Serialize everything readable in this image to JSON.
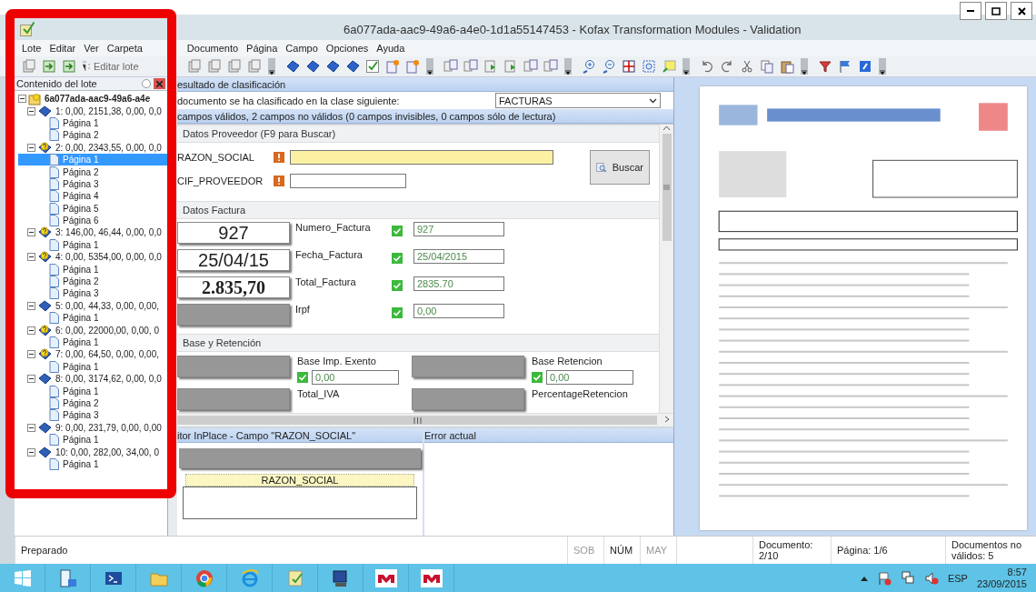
{
  "window": {
    "title": "6a077ada-aac9-49a6-a4e0-1d1a55147453 - Kofax Transformation Modules - Validation"
  },
  "menu": [
    "Lote",
    "Editar",
    "Ver",
    "Carpeta",
    "Documento",
    "Página",
    "Campo",
    "Opciones",
    "Ayuda"
  ],
  "batch_toolbar": {
    "button": "Editar lote"
  },
  "batch_panel": {
    "title": "Contenido del lote",
    "root": {
      "label": "6a077ada-aac9-49a6-a4e",
      "expanded": true,
      "children": [
        {
          "label": "1: 0,00, 2151,38, 0,00, 0,0",
          "valid": true,
          "expanded": true,
          "children": [
            {
              "label": "Página 1",
              "selected": false
            },
            {
              "label": "Página 2",
              "selected": false
            }
          ]
        },
        {
          "label": "2: 0,00, 2343,55, 0,00, 0,0",
          "valid": false,
          "expanded": true,
          "children": [
            {
              "label": "Página 1",
              "selected": true
            },
            {
              "label": "Página 2",
              "selected": false
            },
            {
              "label": "Página 3",
              "selected": false
            },
            {
              "label": "Página 4",
              "selected": false
            },
            {
              "label": "Página 5",
              "selected": false
            },
            {
              "label": "Página 6",
              "selected": false
            }
          ]
        },
        {
          "label": "3: 146,00, 46,44, 0,00, 0,0",
          "valid": false,
          "expanded": true,
          "children": [
            {
              "label": "Página 1",
              "selected": false
            }
          ]
        },
        {
          "label": "4: 0,00, 5354,00, 0,00, 0,0",
          "valid": false,
          "expanded": true,
          "children": [
            {
              "label": "Página 1",
              "selected": false
            },
            {
              "label": "Página 2",
              "selected": false
            },
            {
              "label": "Página 3",
              "selected": false
            }
          ]
        },
        {
          "label": "5: 0,00, 44,33, 0,00, 0,00,",
          "valid": true,
          "expanded": true,
          "children": [
            {
              "label": "Página 1",
              "selected": false
            }
          ]
        },
        {
          "label": "6: 0,00, 22000,00, 0,00, 0",
          "valid": false,
          "expanded": true,
          "children": [
            {
              "label": "Página 1",
              "selected": false
            }
          ]
        },
        {
          "label": "7: 0,00, 64,50, 0,00, 0,00,",
          "valid": false,
          "expanded": true,
          "children": [
            {
              "label": "Página 1",
              "selected": false
            }
          ]
        },
        {
          "label": "8: 0,00, 3174,62, 0,00, 0,0",
          "valid": true,
          "expanded": true,
          "children": [
            {
              "label": "Página 1",
              "selected": false
            },
            {
              "label": "Página 2",
              "selected": false
            },
            {
              "label": "Página 3",
              "selected": false
            }
          ]
        },
        {
          "label": "9: 0,00, 231,79, 0,00, 0,00",
          "valid": true,
          "expanded": true,
          "children": [
            {
              "label": "Página 1",
              "selected": false
            }
          ]
        },
        {
          "label": "10: 0,00, 282,00, 34,00, 0",
          "valid": true,
          "expanded": true,
          "children": [
            {
              "label": "Página 1",
              "selected": false
            }
          ]
        }
      ]
    }
  },
  "classification": {
    "title": "esultado de clasificación",
    "text": "documento se ha clasificado en la clase siguiente:",
    "class": "FACTURAS"
  },
  "validation_summary": "campos válidos, 2 campos no válidos (0 campos invisibles, 0 campos sólo de lectura)",
  "sections": [
    {
      "title": "Datos Proveedor (F9 para Buscar)",
      "kind": "search",
      "button": "Buscar",
      "fields": [
        {
          "kind": "text",
          "label": "RAZON_SOCIAL",
          "valid": false,
          "selected": true
        },
        {
          "kind": "text",
          "label": "CIF_PROVEEDOR",
          "valid": false,
          "selected": false
        }
      ]
    },
    {
      "title": "Datos Factura",
      "kind": "rows",
      "fields": [
        {
          "kind": "text",
          "snippet": {
            "kind": "sans",
            "text": "927"
          },
          "label": "Numero_Factura",
          "valid": true,
          "selected": false,
          "value": "927"
        },
        {
          "kind": "text",
          "snippet": {
            "kind": "sans",
            "text": "25/04/15"
          },
          "label": "Fecha_Factura",
          "valid": true,
          "selected": false,
          "value": "25/04/2015"
        },
        {
          "kind": "text",
          "snippet": {
            "kind": "serif",
            "text": "2.835,70"
          },
          "label": "Total_Factura",
          "valid": true,
          "selected": false,
          "value": "2835.70"
        },
        {
          "kind": "text",
          "snippet": {
            "kind": "blank"
          },
          "label": "Irpf",
          "valid": true,
          "selected": false,
          "value": "0,00"
        }
      ]
    },
    {
      "title": "Base y Retención",
      "kind": "grid",
      "fields": [
        {
          "kind": "text",
          "snippet": {
            "kind": "blank"
          },
          "label": "Base Imp. Exento",
          "valid": true,
          "selected": false,
          "value": "0,00"
        },
        {
          "kind": "text",
          "snippet": {
            "kind": "blank"
          },
          "label": "Base Retencion",
          "valid": true,
          "selected": false,
          "value": "0,00"
        },
        {
          "kind": "label",
          "snippet": {
            "kind": "blank"
          },
          "label": "Total_IVA",
          "selected": false
        },
        {
          "kind": "label",
          "snippet": {
            "kind": "blank"
          },
          "label": "PercentageRetencion",
          "selected": false
        }
      ]
    }
  ],
  "editor": {
    "title": "itor InPlace - Campo \"RAZON_SOCIAL\"",
    "label": "RAZON_SOCIAL"
  },
  "error_panel": {
    "title": "Error actual"
  },
  "status_bar": {
    "message": "Preparado",
    "indicators": [
      {
        "label": "SOB",
        "on": false
      },
      {
        "label": "NÚM",
        "on": true
      },
      {
        "label": "MAY",
        "on": false
      }
    ],
    "document": "Documento: 2/10",
    "page": "Página: 1/6",
    "invalid": "Documentos no válidos: 5"
  },
  "taskbar": {
    "language": "ESP",
    "time": "8:57",
    "date": "23/09/2015"
  }
}
